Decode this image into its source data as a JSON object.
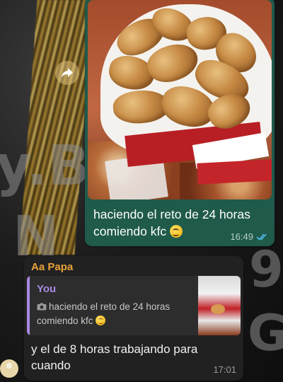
{
  "chat_wallpaper": {
    "texts": [
      "y.B",
      "N",
      "9",
      "G"
    ]
  },
  "outgoing_message": {
    "photo": "kfc-bucket-fried-chicken-photo",
    "caption": "haciendo el reto de 24 horas comiendo kfc",
    "emoji": "grinning-face",
    "time": "16:49",
    "status": "read",
    "status_color": "#53bdeb"
  },
  "forward_button": {
    "icon": "forward-arrow-icon"
  },
  "incoming_message": {
    "sender": "Aa Papa",
    "sender_color": "#e9a23b",
    "reply": {
      "author": "You",
      "author_color": "#a889e0",
      "icon": "camera-icon",
      "text": "haciendo el reto de 24 horas comiendo kfc",
      "emoji": "grinning-face",
      "thumbnail": "kfc-bucket-thumbnail"
    },
    "text": "y el de 8 horas trabajando para cuando",
    "time": "17:01"
  },
  "avatar": {
    "icon": "contact-avatar-icon"
  },
  "colors": {
    "outgoing_bubble": "#1f5a4b",
    "incoming_bubble": "#212121",
    "quote_background": "#2d2d2d"
  }
}
